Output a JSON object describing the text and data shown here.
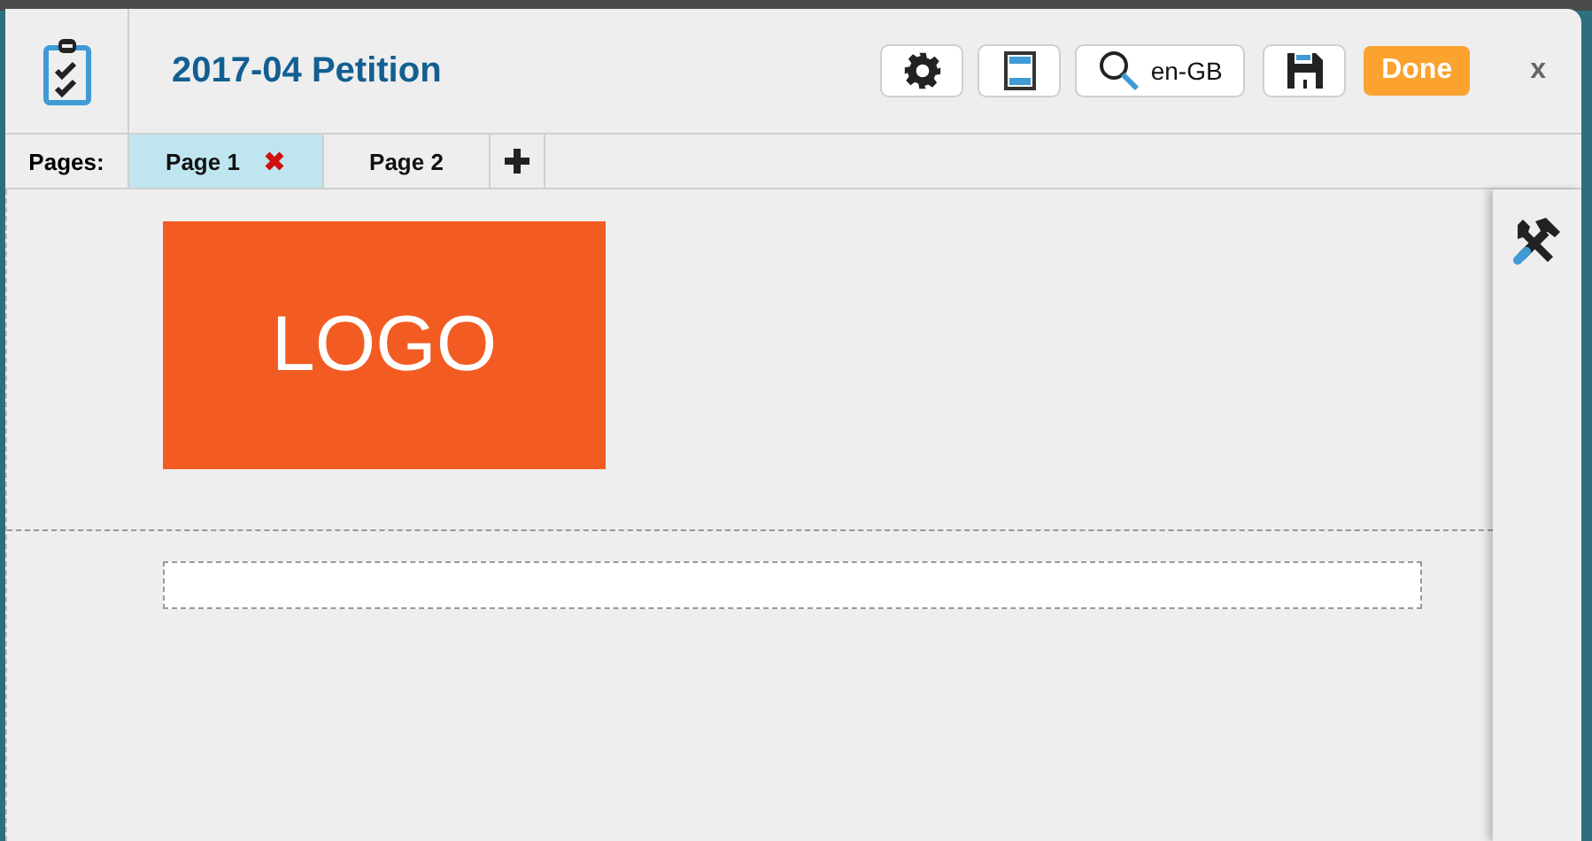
{
  "window": {
    "title": "2017-04 Petition"
  },
  "toolbar": {
    "language": "en-GB",
    "done": "Done",
    "close": "x"
  },
  "pages": {
    "label": "Pages:",
    "tabs": [
      {
        "label": "Page 1",
        "selected": true
      },
      {
        "label": "Page 2",
        "selected": false
      }
    ]
  },
  "canvas": {
    "logo": "LOGO"
  }
}
